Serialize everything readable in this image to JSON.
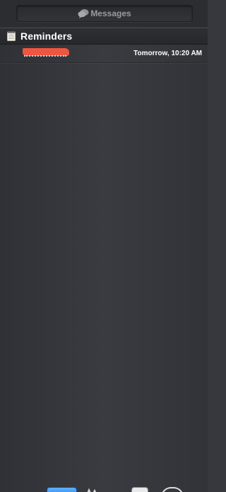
{
  "header": {
    "messages_label": "Messages",
    "messages_icon": "messages-bubbles-icon"
  },
  "reminders": {
    "section_title": "Reminders",
    "section_icon": "notepad-icon",
    "items": [
      {
        "title": "",
        "title_redacted": true,
        "time": "Tomorrow, 10:20 AM"
      }
    ]
  },
  "colors": {
    "background": "#37383d",
    "text_primary": "#ffffff",
    "text_muted": "#9a9ba0",
    "redaction": "#f0553f"
  },
  "dock": {
    "icons": [
      "blue-app-icon",
      "cocoa-icon",
      "document-icon",
      "ring-icon"
    ]
  }
}
